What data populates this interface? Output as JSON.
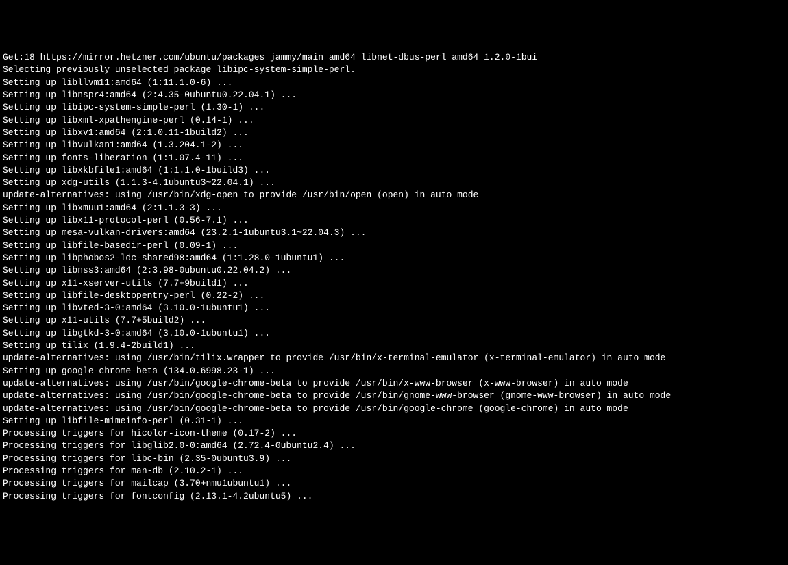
{
  "terminal": {
    "lines": [
      "Get:18 https://mirror.hetzner.com/ubuntu/packages jammy/main amd64 libnet-dbus-perl amd64 1.2.0-1bui",
      "Selecting previously unselected package libipc-system-simple-perl.",
      "Setting up libllvm11:amd64 (1:11.1.0-6) ...",
      "Setting up libnspr4:amd64 (2:4.35-0ubuntu0.22.04.1) ...",
      "Setting up libipc-system-simple-perl (1.30-1) ...",
      "Setting up libxml-xpathengine-perl (0.14-1) ...",
      "Setting up libxv1:amd64 (2:1.0.11-1build2) ...",
      "Setting up libvulkan1:amd64 (1.3.204.1-2) ...",
      "Setting up fonts-liberation (1:1.07.4-11) ...",
      "Setting up libxkbfile1:amd64 (1:1.1.0-1build3) ...",
      "Setting up xdg-utils (1.1.3-4.1ubuntu3~22.04.1) ...",
      "update-alternatives: using /usr/bin/xdg-open to provide /usr/bin/open (open) in auto mode",
      "Setting up libxmuu1:amd64 (2:1.1.3-3) ...",
      "Setting up libx11-protocol-perl (0.56-7.1) ...",
      "Setting up mesa-vulkan-drivers:amd64 (23.2.1-1ubuntu3.1~22.04.3) ...",
      "Setting up libfile-basedir-perl (0.09-1) ...",
      "Setting up libphobos2-ldc-shared98:amd64 (1:1.28.0-1ubuntu1) ...",
      "Setting up libnss3:amd64 (2:3.98-0ubuntu0.22.04.2) ...",
      "Setting up x11-xserver-utils (7.7+9build1) ...",
      "Setting up libfile-desktopentry-perl (0.22-2) ...",
      "Setting up libvted-3-0:amd64 (3.10.0-1ubuntu1) ...",
      "Setting up x11-utils (7.7+5build2) ...",
      "Setting up libgtkd-3-0:amd64 (3.10.0-1ubuntu1) ...",
      "Setting up tilix (1.9.4-2build1) ...",
      "update-alternatives: using /usr/bin/tilix.wrapper to provide /usr/bin/x-terminal-emulator (x-terminal-emulator) in auto mode",
      "Setting up google-chrome-beta (134.0.6998.23-1) ...",
      "update-alternatives: using /usr/bin/google-chrome-beta to provide /usr/bin/x-www-browser (x-www-browser) in auto mode",
      "update-alternatives: using /usr/bin/google-chrome-beta to provide /usr/bin/gnome-www-browser (gnome-www-browser) in auto mode",
      "update-alternatives: using /usr/bin/google-chrome-beta to provide /usr/bin/google-chrome (google-chrome) in auto mode",
      "Setting up libfile-mimeinfo-perl (0.31-1) ...",
      "Processing triggers for hicolor-icon-theme (0.17-2) ...",
      "Processing triggers for libglib2.0-0:amd64 (2.72.4-0ubuntu2.4) ...",
      "Processing triggers for libc-bin (2.35-0ubuntu3.9) ...",
      "Processing triggers for man-db (2.10.2-1) ...",
      "Processing triggers for mailcap (3.70+nmu1ubuntu1) ...",
      "Processing triggers for fontconfig (2.13.1-4.2ubuntu5) ..."
    ]
  }
}
